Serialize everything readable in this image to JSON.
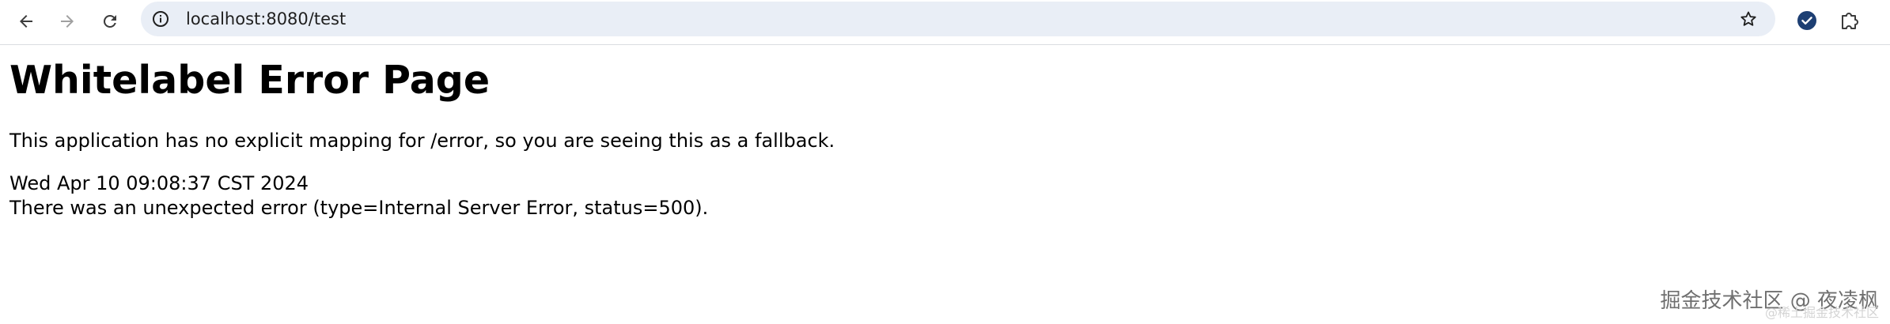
{
  "browser": {
    "url": "localhost:8080/test",
    "icons": {
      "back": "arrow-left-icon",
      "forward": "arrow-right-icon",
      "reload": "reload-icon",
      "site_info": "info-icon",
      "bookmark": "star-icon",
      "profile_extension": "check-circle-icon",
      "extensions": "puzzle-icon"
    },
    "colors": {
      "omnibox_bg": "#e9eef6",
      "profile_badge": "#1d3f73"
    }
  },
  "page": {
    "title": "Whitelabel Error Page",
    "message": "This application has no explicit mapping for /error, so you are seeing this as a fallback.",
    "timestamp": "Wed Apr 10 09:08:37 CST 2024",
    "error_detail": "There was an unexpected error (type=Internal Server Error, status=500)."
  },
  "watermark": {
    "text": "掘金技术社区 @ 夜凌枫",
    "ghost_text": "@稀土掘金技术社区"
  }
}
